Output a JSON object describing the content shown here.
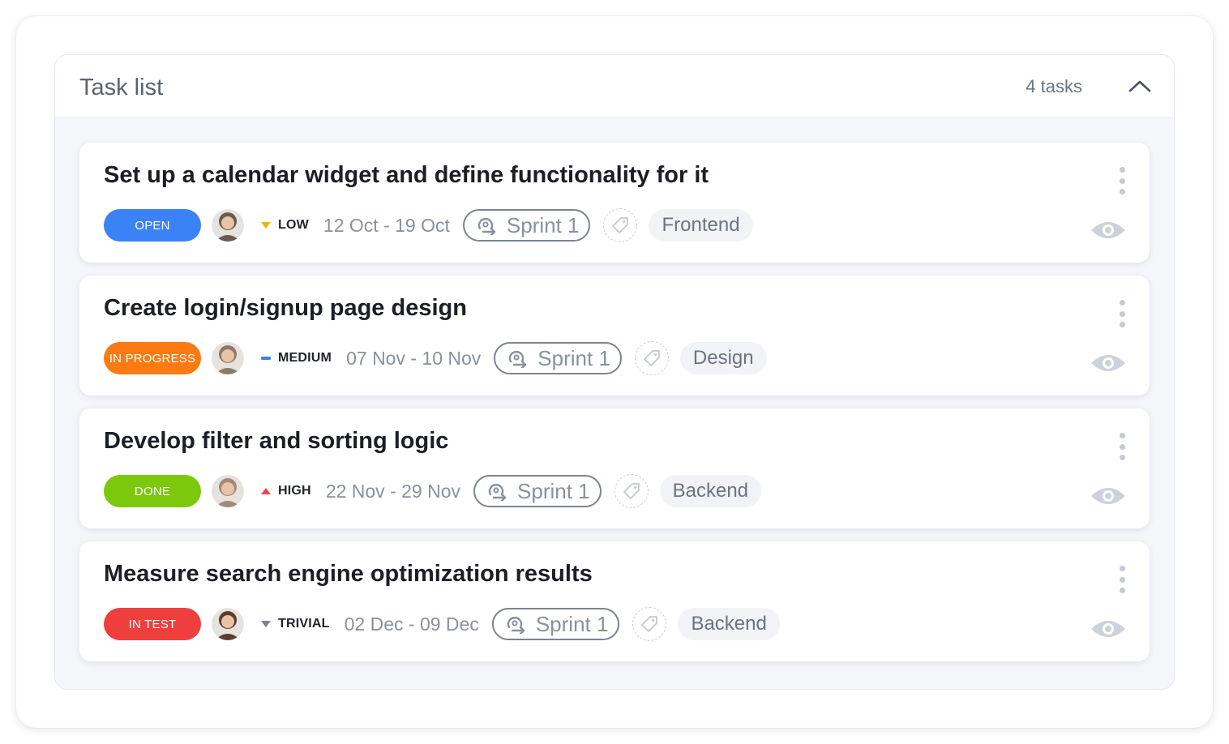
{
  "panel": {
    "title": "Task list",
    "task_count": "4 tasks"
  },
  "tasks": [
    {
      "title": "Set up a calendar widget and define functionality for it",
      "status": "OPEN",
      "status_color": "#3b82f6",
      "priority": "LOW",
      "priority_icon": "caret-down-icon",
      "priority_color": "#f5b300",
      "dates": "12 Oct - 19 Oct",
      "sprint": "Sprint 1",
      "label": "Frontend",
      "avatar_tone": "#6b5a4e"
    },
    {
      "title": "Create login/signup page design",
      "status": "IN PROGRESS",
      "status_color": "#fb7a12",
      "priority": "MEDIUM",
      "priority_icon": "dash-icon",
      "priority_color": "#3b82f6",
      "dates": "07 Nov - 10 Nov",
      "sprint": "Sprint 1",
      "label": "Design",
      "avatar_tone": "#8a7a6a"
    },
    {
      "title": "Develop filter and sorting logic",
      "status": "DONE",
      "status_color": "#7cc80c",
      "priority": "HIGH",
      "priority_icon": "caret-up-icon",
      "priority_color": "#f04444",
      "dates": "22 Nov - 29 Nov",
      "sprint": "Sprint 1",
      "label": "Backend",
      "avatar_tone": "#a08a78"
    },
    {
      "title": "Measure search engine optimization results",
      "status": "IN TEST",
      "status_color": "#ee3e3e",
      "priority": "TRIVIAL",
      "priority_icon": "caret-down-icon",
      "priority_color": "#7c8393",
      "dates": "02 Dec - 09 Dec",
      "sprint": "Sprint 1",
      "label": "Backend",
      "avatar_tone": "#5a3e32"
    }
  ]
}
